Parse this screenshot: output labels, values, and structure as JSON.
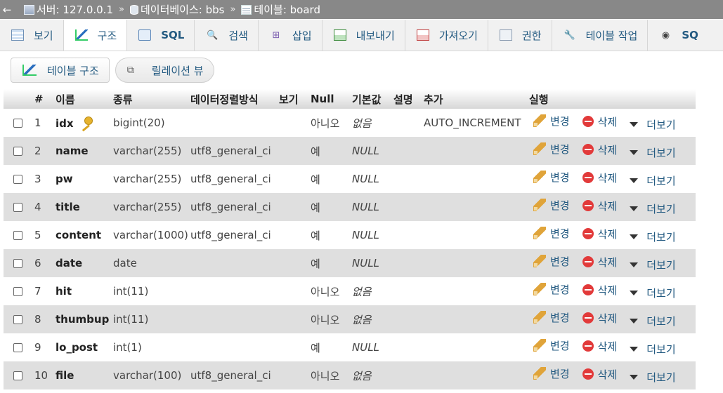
{
  "breadcrumb": {
    "back_glyph": "←",
    "server": "서버: 127.0.0.1",
    "database": "데이터베이스: bbs",
    "table": "테이블: board",
    "separator": "»"
  },
  "tabs": [
    {
      "label": "보기",
      "icon": "browse-icon"
    },
    {
      "label": "구조",
      "icon": "structure-icon",
      "active": true
    },
    {
      "label": "SQL",
      "icon": "sql-icon"
    },
    {
      "label": "검색",
      "icon": "search-icon"
    },
    {
      "label": "삽입",
      "icon": "insert-icon"
    },
    {
      "label": "내보내기",
      "icon": "export-icon"
    },
    {
      "label": "가져오기",
      "icon": "import-icon"
    },
    {
      "label": "권한",
      "icon": "privileges-icon"
    },
    {
      "label": "테이블 작업",
      "icon": "operations-icon"
    },
    {
      "label": "SQ",
      "icon": "tracking-icon"
    }
  ],
  "subtabs": {
    "table_structure": "테이블 구조",
    "relation_view": "릴레이션 뷰"
  },
  "columns": {
    "num": "#",
    "name": "이름",
    "type": "종류",
    "collation": "데이터정렬방식",
    "attributes": "보기",
    "null": "Null",
    "default": "기본값",
    "comment": "설명",
    "extra": "추가",
    "action": "실행"
  },
  "actions": {
    "change": "변경",
    "drop": "삭제",
    "more": "더보기"
  },
  "rows": [
    {
      "num": "1",
      "name": "idx",
      "type": "bigint(20)",
      "collation": "",
      "null": "아니오",
      "default": "없음",
      "extra": "AUTO_INCREMENT",
      "primary": true
    },
    {
      "num": "2",
      "name": "name",
      "type": "varchar(255)",
      "collation": "utf8_general_ci",
      "null": "예",
      "default": "NULL",
      "extra": ""
    },
    {
      "num": "3",
      "name": "pw",
      "type": "varchar(255)",
      "collation": "utf8_general_ci",
      "null": "예",
      "default": "NULL",
      "extra": ""
    },
    {
      "num": "4",
      "name": "title",
      "type": "varchar(255)",
      "collation": "utf8_general_ci",
      "null": "예",
      "default": "NULL",
      "extra": ""
    },
    {
      "num": "5",
      "name": "content",
      "type": "varchar(1000)",
      "collation": "utf8_general_ci",
      "null": "예",
      "default": "NULL",
      "extra": ""
    },
    {
      "num": "6",
      "name": "date",
      "type": "date",
      "collation": "",
      "null": "예",
      "default": "NULL",
      "extra": ""
    },
    {
      "num": "7",
      "name": "hit",
      "type": "int(11)",
      "collation": "",
      "null": "아니오",
      "default": "없음",
      "extra": ""
    },
    {
      "num": "8",
      "name": "thumbup",
      "type": "int(11)",
      "collation": "",
      "null": "아니오",
      "default": "없음",
      "extra": ""
    },
    {
      "num": "9",
      "name": "lo_post",
      "type": "int(1)",
      "collation": "",
      "null": "예",
      "default": "NULL",
      "extra": ""
    },
    {
      "num": "10",
      "name": "file",
      "type": "varchar(100)",
      "collation": "utf8_general_ci",
      "null": "아니오",
      "default": "없음",
      "extra": ""
    }
  ]
}
